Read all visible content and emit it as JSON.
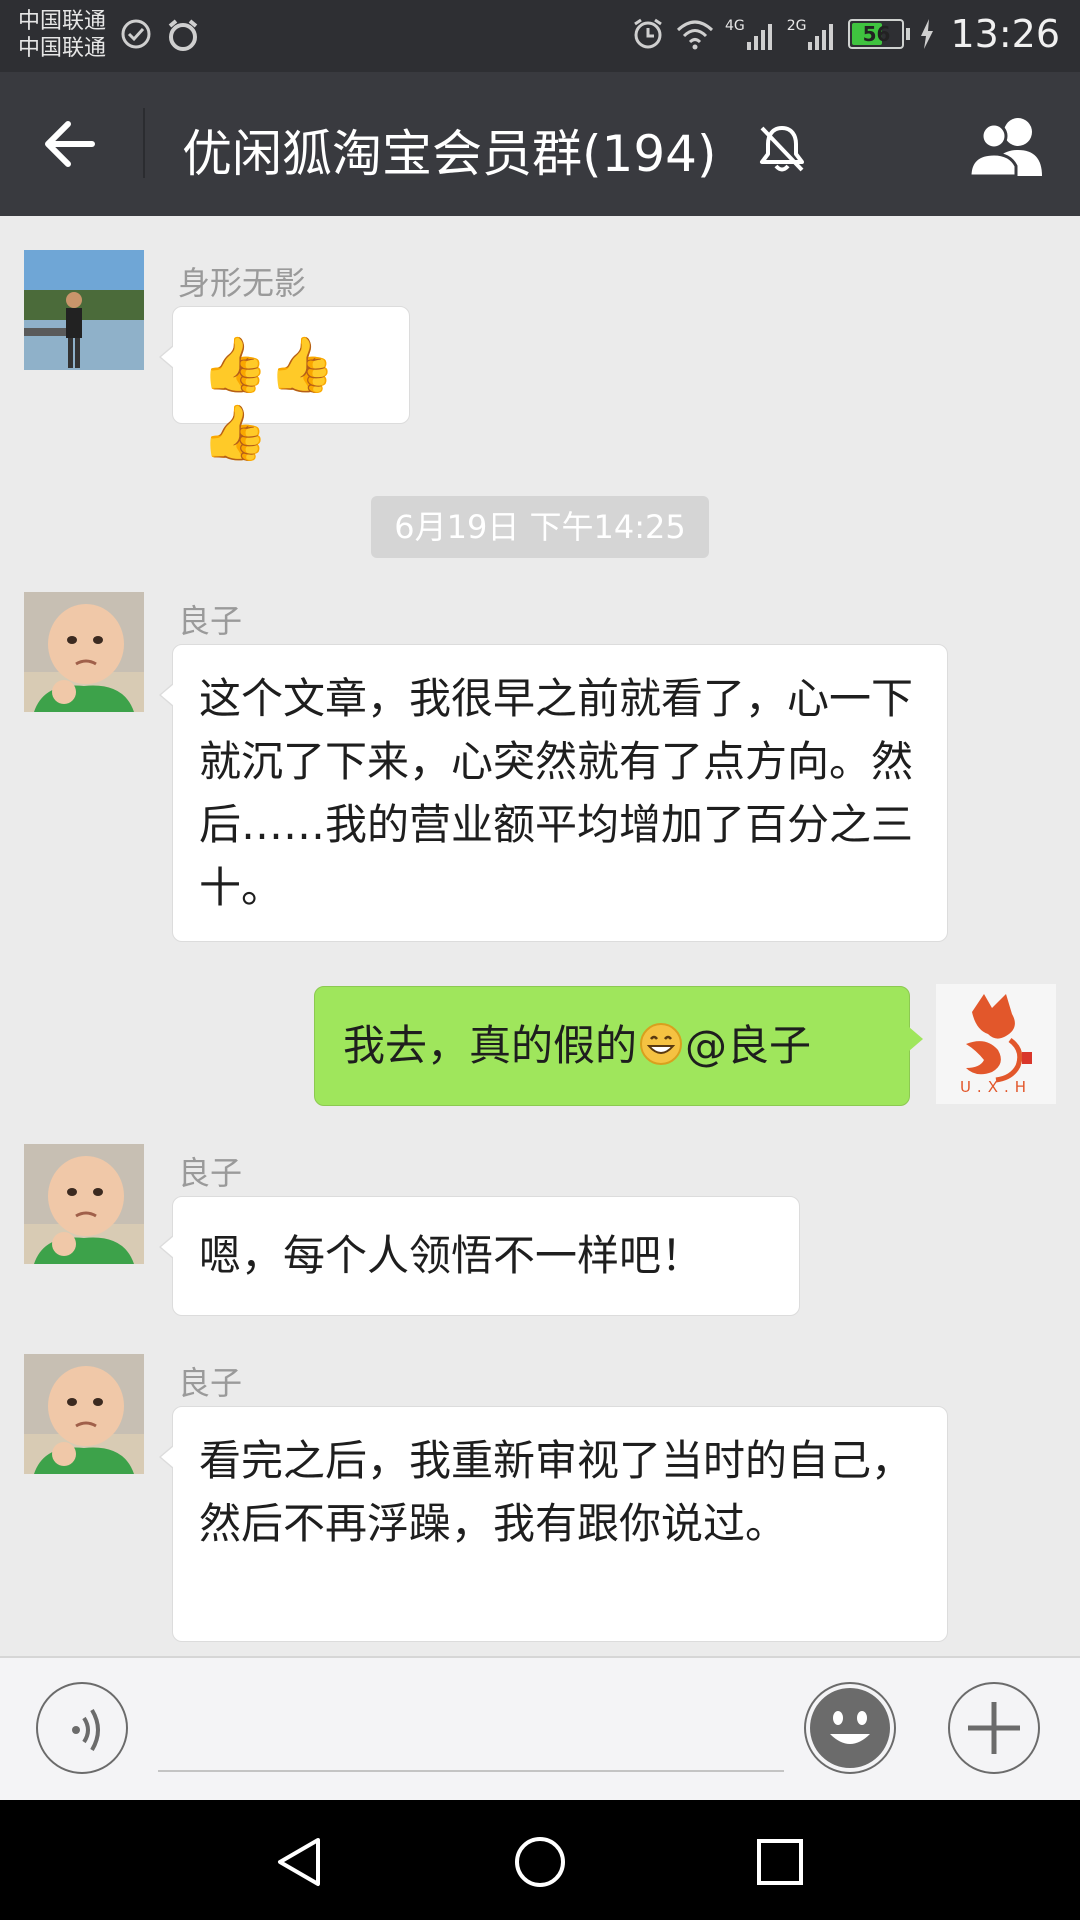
{
  "status_bar": {
    "carrier_1": "中国联通",
    "carrier_2": "中国联通",
    "network_1": "4G",
    "network_2": "2G",
    "battery": "56",
    "time": "13:26"
  },
  "header": {
    "title": "优闲狐淘宝会员群(194)",
    "muted": true
  },
  "messages": [
    {
      "sender": "身形无影",
      "text": "👍👍👍"
    },
    {
      "timestamp": "6月19日 下午14:25"
    },
    {
      "sender": "良子",
      "text": "这个文章，我很早之前就看了，心一下就沉了下来，心突然就有了点方向。然后……我的营业额平均增加了百分之三十。"
    },
    {
      "sender": "me",
      "text": "我去，真的假的",
      "mention": "@良子",
      "avatar_text": "U.X.H"
    },
    {
      "sender": "良子",
      "text": "嗯，每个人领悟不一样吧！"
    },
    {
      "sender": "良子",
      "text": "看完之后，我重新审视了当时的自己，然后不再浮躁，我有跟你说过。"
    }
  ],
  "input": {
    "placeholder": ""
  },
  "colors": {
    "my_bubble": "#9fe65c",
    "top_bar": "#393a3f",
    "status_bar": "#2e2f33",
    "chat_bg": "#ebebeb"
  }
}
